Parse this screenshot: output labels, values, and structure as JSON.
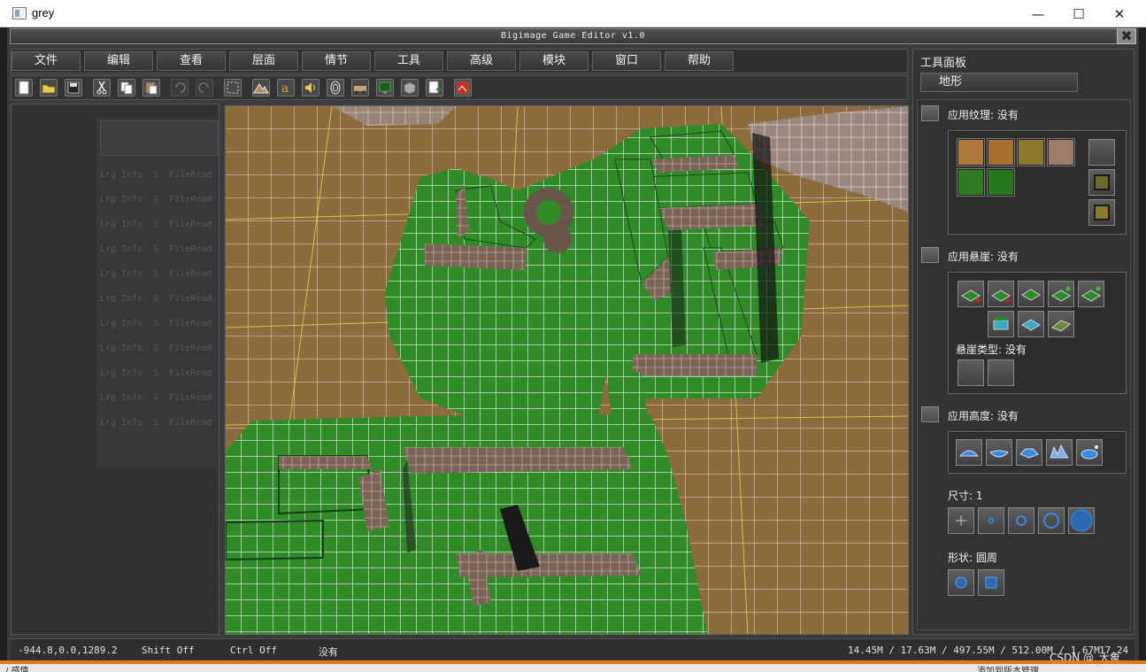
{
  "window": {
    "title": "grey",
    "minimize_glyph": "—",
    "maximize_glyph": "☐",
    "close_glyph": "✕"
  },
  "editor": {
    "title": "Bigimage Game Editor v1.0",
    "close_glyph": "✖"
  },
  "menu": {
    "items": [
      "文件",
      "编辑",
      "查看",
      "层面",
      "情节",
      "工具",
      "高级",
      "模块",
      "窗口",
      "帮助"
    ]
  },
  "toolbar": {
    "buttons": [
      "new-file-icon",
      "open-folder-icon",
      "save-icon",
      "cut-icon",
      "copy-icon",
      "paste-icon",
      "undo-icon",
      "redo-icon",
      "select-rect-icon",
      "terrain-icon",
      "text-icon",
      "sound-icon",
      "fingerprint-icon",
      "vehicle-icon",
      "monitor-icon",
      "box-icon",
      "doc-add-icon",
      "image-icon"
    ],
    "disabled": [
      "undo-icon",
      "redo-icon"
    ]
  },
  "console": {
    "line_prefix": "Lrg Info  S  FileRead",
    "lines": [
      "Lrg Info  S  FileRead",
      "Lrg Info  S  FileRead",
      "Lrg Info  S  FileRead",
      "Lrg Info  S  FileRead",
      "Lrg Info  S  FileRead",
      "Lrg Info  S  FileRead",
      "Lrg Info  S  FileRead",
      "Lrg Info  S  FileRead",
      "Lrg Info  S  FileRead",
      "Lrg Info  S  FileRead",
      "Lrg Info  S  FileRead"
    ]
  },
  "tool_panel": {
    "title": "工具面板",
    "tab_label": "地形",
    "texture": {
      "label": "应用纹理: 没有",
      "swatch_colors": [
        "#b07a3a",
        "#a8722e",
        "#8a7a2a",
        "#a07a6a",
        "#2e7a22",
        "#267a1e"
      ]
    },
    "cliff": {
      "label": "应用悬崖: 没有",
      "type_label": "悬崖类型: 没有"
    },
    "height": {
      "label": "应用高度: 没有"
    },
    "size": {
      "label": "尺寸: 1"
    },
    "shape": {
      "label": "形状: 圆周"
    }
  },
  "status": {
    "coords": "-944.8,0.0,1289.2",
    "shift": "Shift Off",
    "ctrl": "Ctrl Off",
    "mode": "没有",
    "memory": "14.45M / 17.63M / 497.55M / 512.00M / 1.67M",
    "fps": "17.24"
  },
  "taskbar": {
    "left_text": "/ 感情",
    "right_text": "添加到版本管理",
    "watermark": "CSDN @_大象_"
  },
  "colors": {
    "grass": "#2e8a2a",
    "dirt": "#8a6a3a",
    "grid_white": "#ffffff",
    "grid_yellow": "#e8d84a",
    "cliff": "#8a7060",
    "accent_orange": "#e07b20"
  }
}
